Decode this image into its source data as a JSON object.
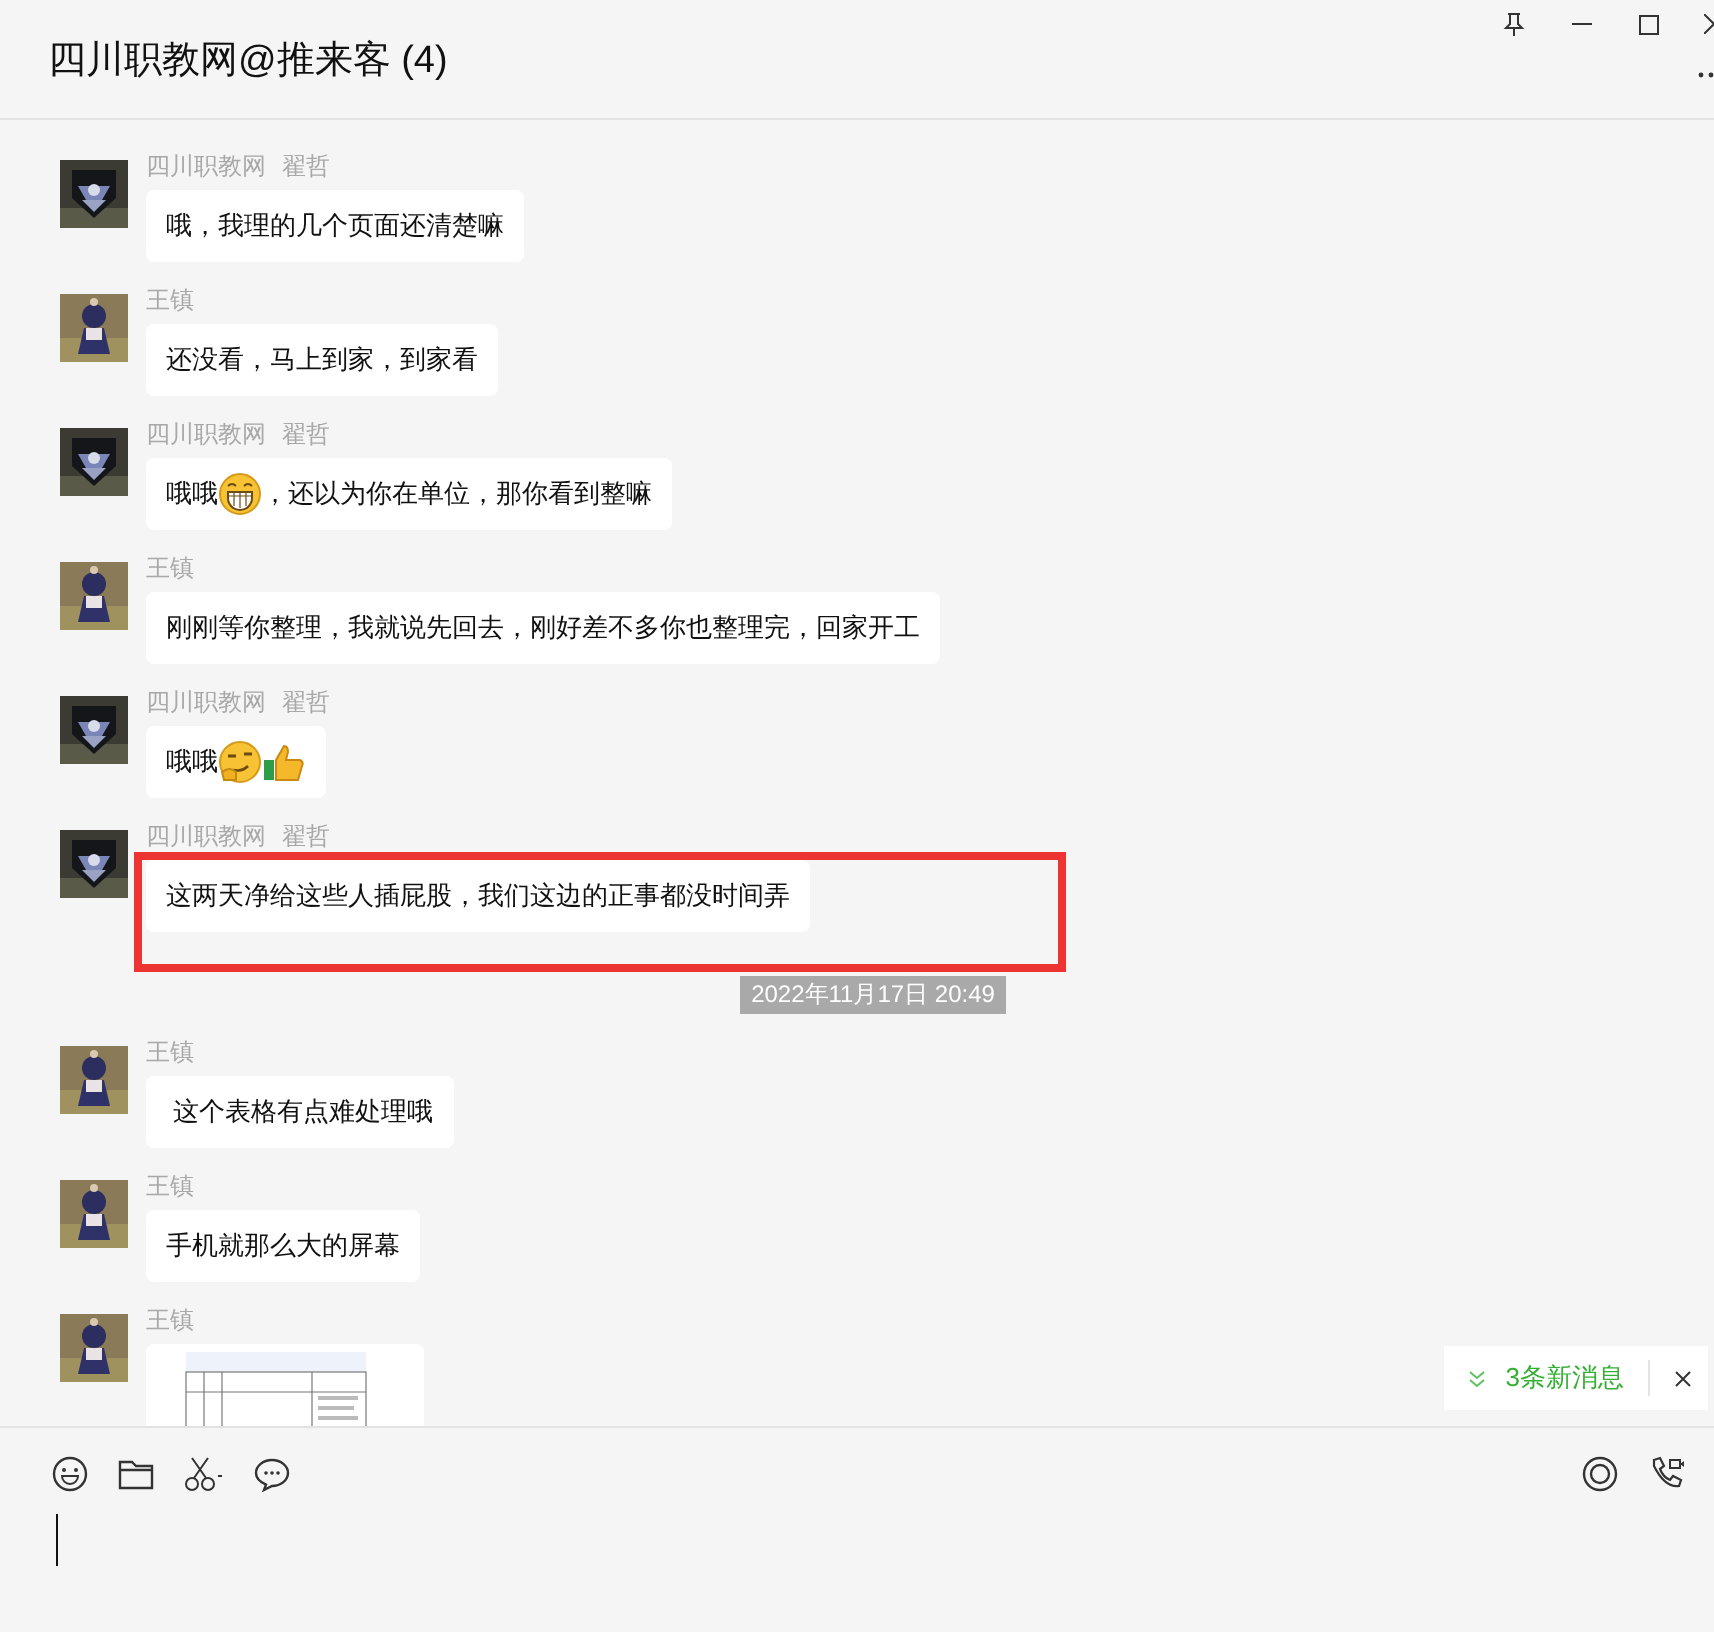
{
  "window": {
    "title": "四川职教网@推来客 (4)"
  },
  "messages": [
    {
      "sender": "四川职教网",
      "tag": "翟哲",
      "avatar": {
        "kind": "badge"
      },
      "highlighted": false,
      "kind": "text",
      "parts": [
        {
          "kind": "text",
          "text": "哦，我理的几个页面还清楚嘛"
        }
      ]
    },
    {
      "sender": "王镇",
      "avatar": {
        "kind": "figure"
      },
      "highlighted": false,
      "kind": "text",
      "parts": [
        {
          "kind": "text",
          "text": "还没看，马上到家，到家看"
        }
      ]
    },
    {
      "sender": "四川职教网",
      "tag": "翟哲",
      "avatar": {
        "kind": "badge"
      },
      "highlighted": false,
      "kind": "text",
      "parts": [
        {
          "kind": "text",
          "text": "哦哦"
        },
        {
          "kind": "grin"
        },
        {
          "kind": "text",
          "text": "，还以为你在单位，那你看到整嘛"
        }
      ]
    },
    {
      "sender": "王镇",
      "avatar": {
        "kind": "figure"
      },
      "highlighted": false,
      "kind": "text",
      "parts": [
        {
          "kind": "text",
          "text": "刚刚等你整理，我就说先回去，刚好差不多你也整理完，回家开工"
        }
      ]
    },
    {
      "sender": "四川职教网",
      "tag": "翟哲",
      "avatar": {
        "kind": "badge"
      },
      "highlighted": false,
      "kind": "text",
      "parts": [
        {
          "kind": "text",
          "text": "哦哦"
        },
        {
          "kind": "smirk"
        },
        {
          "kind": "thumbs"
        }
      ]
    },
    {
      "sender": "四川职教网",
      "tag": "翟哲",
      "avatar": {
        "kind": "badge"
      },
      "highlighted": true,
      "kind": "text",
      "parts": [
        {
          "kind": "text",
          "text": "这两天净给这些人插屁股，我们这边的正事都没时间弄"
        }
      ],
      "timestamp": "2022年11月17日 20:49"
    },
    {
      "sender": "王镇",
      "avatar": {
        "kind": "figure"
      },
      "highlighted": false,
      "kind": "text",
      "parts": [
        {
          "kind": "text",
          "text": " 这个表格有点难处理哦"
        }
      ]
    },
    {
      "sender": "王镇",
      "avatar": {
        "kind": "figure"
      },
      "highlighted": false,
      "kind": "text",
      "parts": [
        {
          "kind": "text",
          "text": "手机就那么大的屏幕"
        }
      ]
    },
    {
      "sender": "王镇",
      "avatar": {
        "kind": "figure"
      },
      "highlighted": false
    }
  ],
  "new_messages": {
    "label": "3条新消息"
  }
}
